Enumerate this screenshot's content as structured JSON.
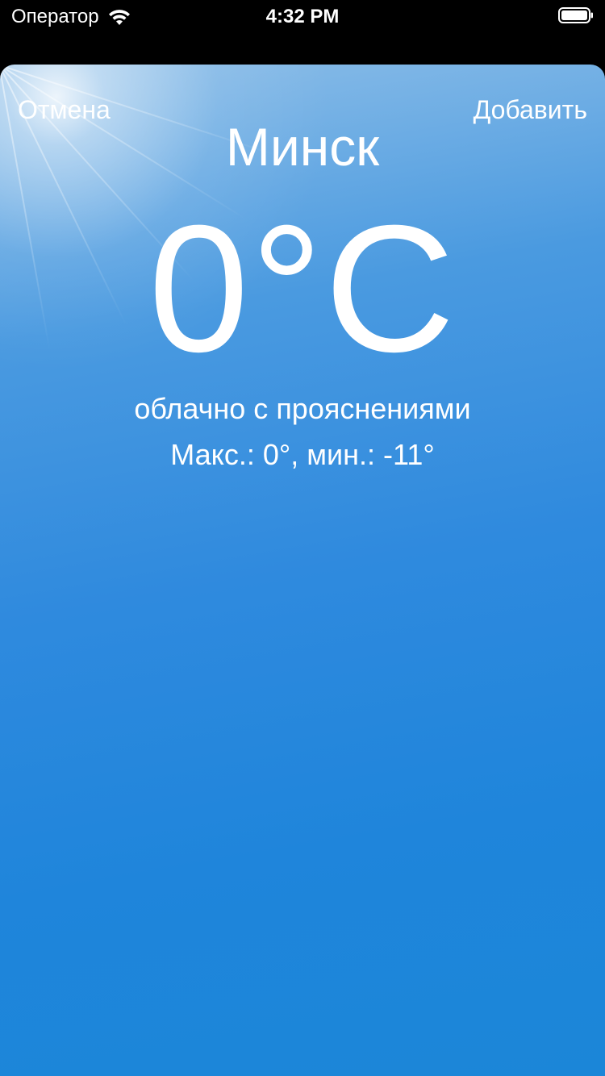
{
  "status_bar": {
    "carrier": "Оператор",
    "time": "4:32 PM",
    "wifi_icon": "wifi-icon",
    "battery_icon": "battery-full-icon"
  },
  "nav": {
    "cancel_label": "Отмена",
    "add_label": "Добавить"
  },
  "weather": {
    "city": "Минск",
    "temperature": "0°C",
    "condition": "облачно с прояснениями",
    "range": "Макс.: 0°, мин.: -11°"
  },
  "colors": {
    "status_bar_background": "#000000",
    "sky_top": "#8fbfe8",
    "sky_bottom": "#1b86d8",
    "text": "#ffffff"
  }
}
